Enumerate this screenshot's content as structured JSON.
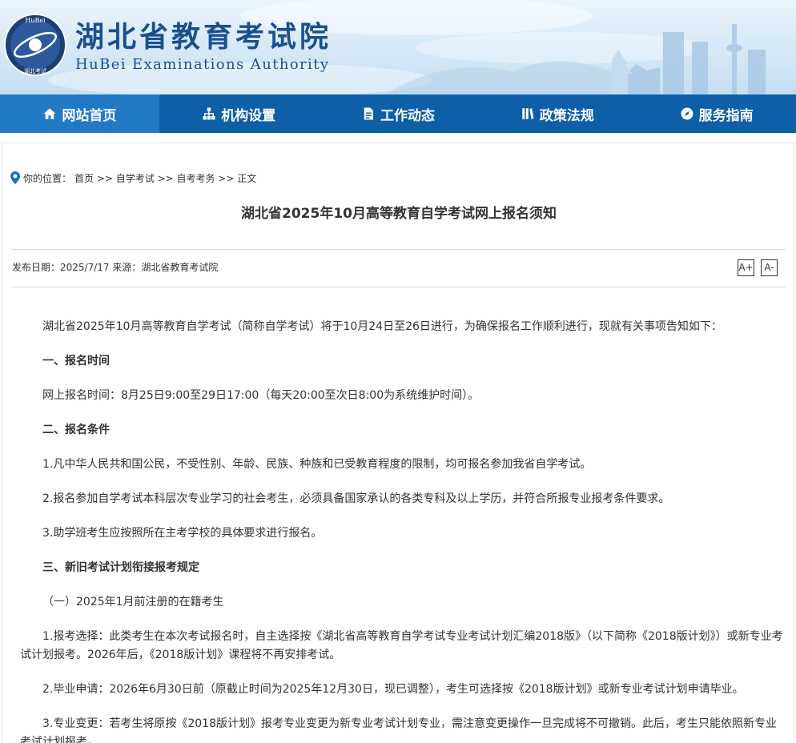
{
  "header": {
    "title": "湖北省教育考试院",
    "subtitle": "HuBei Examinations Authority",
    "emblem_text": "HuBei",
    "emblem_bottom_text": "湖北考试"
  },
  "nav": {
    "items": [
      {
        "label": "网站首页",
        "icon": "home-icon",
        "active": true
      },
      {
        "label": "机构设置",
        "icon": "org-chart-icon",
        "active": false
      },
      {
        "label": "工作动态",
        "icon": "document-icon",
        "active": false
      },
      {
        "label": "政策法规",
        "icon": "books-icon",
        "active": false
      },
      {
        "label": "服务指南",
        "icon": "compass-icon",
        "active": false
      }
    ]
  },
  "breadcrumb": {
    "prefix": "你的位置：",
    "path": "首页 >> 自学考试 >> 自考考务 >> 正文"
  },
  "article": {
    "title": "湖北省2025年10月高等教育自学考试网上报名须知",
    "meta": "发布日期：2025/7/17 来源：湖北省教育考试院",
    "font_increase": "A+",
    "font_decrease": "A-",
    "paragraphs": [
      {
        "text": "湖北省2025年10月高等教育自学考试（简称自学考试）将于10月24日至26日进行，为确保报名工作顺利进行，现就有关事项告知如下：",
        "bold": false
      },
      {
        "text": "一、报名时间",
        "bold": true
      },
      {
        "text": "网上报名时间：8月25日9:00至29日17:00（每天20:00至次日8:00为系统维护时间）。",
        "bold": false
      },
      {
        "text": "二、报名条件",
        "bold": true
      },
      {
        "text": "1.凡中华人民共和国公民，不受性别、年龄、民族、种族和已受教育程度的限制，均可报名参加我省自学考试。",
        "bold": false
      },
      {
        "text": "2.报名参加自学考试本科层次专业学习的社会考生，必须具备国家承认的各类专科及以上学历，并符合所报专业报考条件要求。",
        "bold": false
      },
      {
        "text": "3.助学班考生应按照所在主考学校的具体要求进行报名。",
        "bold": false
      },
      {
        "text": "三、新旧考试计划衔接报考规定",
        "bold": true
      },
      {
        "text": "（一）2025年1月前注册的在籍考生",
        "bold": false
      },
      {
        "text": "1.报考选择：此类考生在本次考试报名时，自主选择按《湖北省高等教育自学考试专业考试计划汇编2018版》（以下简称《2018版计划》）或新专业考试计划报考。2026年后，《2018版计划》课程将不再安排考试。",
        "bold": false
      },
      {
        "text": "2.毕业申请：2026年6月30日前（原截止时间为2025年12月30日，现已调整），考生可选择按《2018版计划》或新专业考试计划申请毕业。",
        "bold": false
      },
      {
        "text": "3.专业变更：若考生将原按《2018版计划》报考专业变更为新专业考试计划专业，需注意变更操作一旦完成将不可撤销。此后，考生只能依照新专业考试计划报考。",
        "bold": false
      }
    ]
  }
}
